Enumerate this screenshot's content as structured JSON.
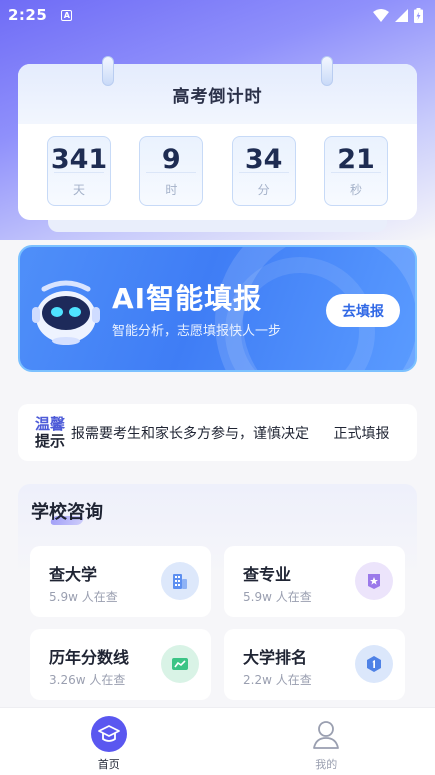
{
  "status": {
    "time": "2:25",
    "notification_glyph": "A"
  },
  "countdown": {
    "title": "高考倒计时",
    "units": [
      {
        "value": "341",
        "label": "天"
      },
      {
        "value": "9",
        "label": "时"
      },
      {
        "value": "34",
        "label": "分"
      },
      {
        "value": "21",
        "label": "秒"
      }
    ]
  },
  "ai_banner": {
    "title": "AI智能填报",
    "subtitle": "智能分析，志愿填报快人一步",
    "button": "去填报"
  },
  "tip": {
    "label_line1": "温馨",
    "label_line2": "提示",
    "messages": [
      "报需要考生和家长多方参与，谨慎决定",
      "正式填报"
    ]
  },
  "school": {
    "title": "学校咨询",
    "cards": [
      {
        "title": "查大学",
        "sub": "5.9w 人在查",
        "icon": "building-icon"
      },
      {
        "title": "查专业",
        "sub": "5.9w 人在查",
        "icon": "star-badge-icon"
      },
      {
        "title": "历年分数线",
        "sub": "3.26w 人在查",
        "icon": "trend-card-icon"
      },
      {
        "title": "大学排名",
        "sub": "2.2w 人在查",
        "icon": "rank-shield-icon"
      }
    ]
  },
  "nav": {
    "home": "首页",
    "mine": "我的"
  },
  "colors": {
    "accent": "#5a57f0",
    "banner": "#3f7df5",
    "tip_label": "#4d5bd8"
  }
}
